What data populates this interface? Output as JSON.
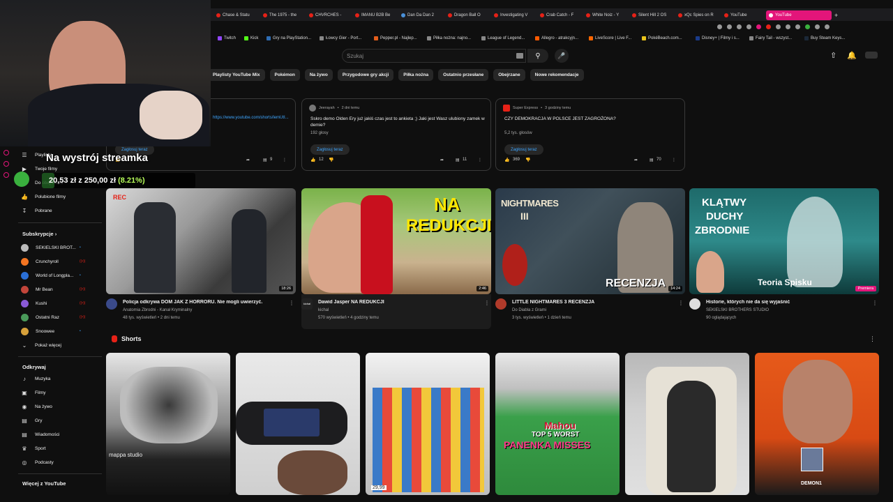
{
  "browser": {
    "tabs": [
      {
        "label": "Chase & Statu"
      },
      {
        "label": "The 1975 - the"
      },
      {
        "label": "CHVRCHES - "
      },
      {
        "label": "IMANU B2B Be"
      },
      {
        "label": "Dan Da Dan 2"
      },
      {
        "label": "Dragon Ball O"
      },
      {
        "label": "Investigating V"
      },
      {
        "label": "Crab Catch - F"
      },
      {
        "label": "White Noiz - Y"
      },
      {
        "label": "Silent Hill 2 OS"
      },
      {
        "label": "xQc Spies on R"
      },
      {
        "label": "YouTube"
      },
      {
        "label": "YouTube"
      }
    ],
    "new_tab_symbol": "+",
    "bookmarks": [
      {
        "label": "Twitch"
      },
      {
        "label": "Kick"
      },
      {
        "label": "Gry na PlayStation..."
      },
      {
        "label": "Łowcy Gier - Port..."
      },
      {
        "label": "Pepper.pl - Najlep..."
      },
      {
        "label": "Piłka nożna: najno..."
      },
      {
        "label": "League of Legend..."
      },
      {
        "label": "Allegro - atrakcyjn..."
      },
      {
        "label": "LiveScore | Live F..."
      },
      {
        "label": "PokéBeach.com..."
      },
      {
        "label": "Disney+ | Filmy i s..."
      },
      {
        "label": "Fairy Tail - wszyst..."
      },
      {
        "label": "Buy Steam Keys..."
      }
    ]
  },
  "header": {
    "search_placeholder": "Szukaj",
    "search_icon": "magnifier",
    "mic_icon": "microphone",
    "upload_icon": "upload",
    "bell_icon": "bell"
  },
  "chips": [
    "Playlisty YouTube Mix",
    "Pokémon",
    "Na żywo",
    "Przygodowe gry akcji",
    "Piłka nożna",
    "Ostatnio przesłane",
    "Obejrzane",
    "Nowe rekomendacje"
  ],
  "posts": [
    {
      "link": "https://www.youtube.com/shorts/lemUtI...",
      "vote_label": "Zagłosuj teraz",
      "comments": "9"
    },
    {
      "author": "Jeerayah",
      "time": "2 dni temu",
      "question": "Sskro demo Olden Ery już jakiś czas jest to ankieta ;) Jaki jest Wasz ulubiony zamek w demie?",
      "votes": "192 głosy",
      "vote_label": "Zagłosuj teraz",
      "likes": "12",
      "comments": "11"
    },
    {
      "author": "Super Express",
      "time": "3 godziny temu",
      "question": "CZY DEMOKRACJA W POLSCE JEST ZAGROŻONA?",
      "votes": "5,2 tys. głosów",
      "vote_label": "Zagłosuj teraz",
      "likes": "369",
      "comments": "70"
    }
  ],
  "sidebar": {
    "top_items": [
      {
        "label": "Playlisty",
        "icon": "playlist"
      },
      {
        "label": "Twoje filmy",
        "icon": "video"
      },
      {
        "label": "Do obejrzenia",
        "icon": "clock"
      },
      {
        "label": "Polubione filmy",
        "icon": "thumb-up"
      },
      {
        "label": "Pobrane",
        "icon": "download"
      }
    ],
    "subscriptions_heading": "Subskrypcje",
    "subscriptions": [
      {
        "label": "SEKIELSKI BROT...",
        "color": "#bbbbbb",
        "badge": "•"
      },
      {
        "label": "Crunchyroll",
        "color": "#f47521",
        "badge": "((•))"
      },
      {
        "label": "World of Longpla...",
        "color": "#2a6fd6",
        "badge": "•"
      },
      {
        "label": "Mr Bean",
        "color": "#c2453a",
        "badge": "((•))"
      },
      {
        "label": "Kushi",
        "color": "#8a5ad6",
        "badge": "((•))"
      },
      {
        "label": "Ostatni Raz",
        "color": "#4a9a5a",
        "badge": "((•))"
      },
      {
        "label": "Snoowee",
        "color": "#d6a03a",
        "badge": "•"
      }
    ],
    "show_more": "Pokaż więcej",
    "explore_heading": "Odkrywaj",
    "explore": [
      {
        "label": "Muzyka",
        "icon": "music"
      },
      {
        "label": "Filmy",
        "icon": "film"
      },
      {
        "label": "Na żywo",
        "icon": "live"
      },
      {
        "label": "Gry",
        "icon": "gamepad"
      },
      {
        "label": "Wiadomości",
        "icon": "news"
      },
      {
        "label": "Sport",
        "icon": "trophy"
      },
      {
        "label": "Podcasty",
        "icon": "podcast"
      }
    ],
    "more_heading": "Więcej z YouTube"
  },
  "stream_overlay": {
    "title": "Na wystrój streamka",
    "current": "20,53 zł",
    "separator": "z",
    "goal": "250,00 zł",
    "percent": "(8.21%)",
    "progress_fraction": 0.0821
  },
  "videos": [
    {
      "title": "Policja odkrywa DOM JAK Z HORRORU. Nie mogli uwierzyć.",
      "channel": "Anatomia Zbrodni - Kanał Kryminalny",
      "stats": "48 tys. wyświetleń • 2 dni temu",
      "duration": "18:26",
      "thumb_badge": "REC",
      "avatar_color": "#3a4a8a"
    },
    {
      "title": "Dawid Jasper NA REDUKCJI",
      "channel": "kichal",
      "stats": "570 wyświetleń • 4 godziny temu",
      "duration": "2:46",
      "thumb_text_1": "NA",
      "thumb_text_2": "REDUKCJI",
      "avatar_label": "kichal",
      "avatar_color": "#222222"
    },
    {
      "title": "LITTLE NIGHTMARES 3 RECENZJA",
      "channel": "Do Diabla z Grami",
      "stats": "3 tys. wyświetleń • 1 dzień temu",
      "duration": "14:24",
      "thumb_text_1": "NIGHTMARES",
      "thumb_text_2": "RECENZJA",
      "thumb_text_3": "III",
      "avatar_color": "#b03a2a"
    },
    {
      "title": "Historie, których nie da się wyjaśnić",
      "channel": "SEKIELSKI BROTHERS STUDIO",
      "stats": "90 oglądających",
      "premiere": "Premiera",
      "thumb_text_1": "KLĄTWY",
      "thumb_text_2": "DUCHY",
      "thumb_text_3": "ZBRODNIE",
      "thumb_text_4": "Teoria Spisku",
      "avatar_color": "#dddddd"
    }
  ],
  "shorts": {
    "heading": "Shorts",
    "items": [
      {
        "overlay": "mappa studio"
      },
      {
        "overlay": ""
      },
      {
        "overlay": "29,99"
      },
      {
        "overlay_1": "TOP 5 WORST",
        "overlay_2": "PANENKA MISSES",
        "overlay_3": "Mahou"
      },
      {
        "overlay": ""
      },
      {
        "overlay": "DEMON1"
      }
    ]
  },
  "colors": {
    "background": "#0f0f0f",
    "chip": "#272727",
    "accent_blue": "#3ea6ff",
    "youtube_red": "#e62117",
    "active_tab": "#e3157a"
  }
}
